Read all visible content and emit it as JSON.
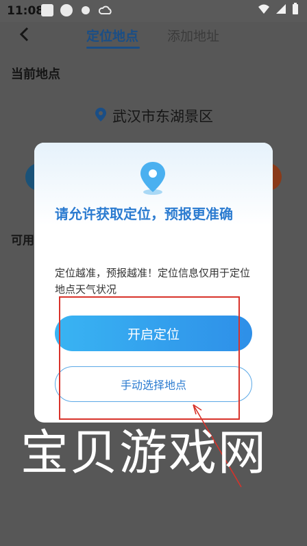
{
  "status_bar": {
    "time": "11:08"
  },
  "header": {
    "tabs": [
      {
        "label": "定位地点",
        "active": true
      },
      {
        "label": "添加地址",
        "active": false
      }
    ]
  },
  "page": {
    "section_current": "当前地点",
    "current_location": "武汉市东湖景区",
    "section_available": "可用"
  },
  "dialog": {
    "title": "请允许获取定位，预报更准确",
    "description": "定位越准，预报越准！定位信息仅用于定位地点天气状况",
    "primary_button": "开启定位",
    "secondary_button": "手动选择地点"
  },
  "watermark": "宝贝游戏网",
  "colors": {
    "accent": "#2b7bd0",
    "button_gradient_start": "#39b4f3",
    "button_gradient_end": "#2e8fe8",
    "annotation_red": "#d8322a"
  }
}
